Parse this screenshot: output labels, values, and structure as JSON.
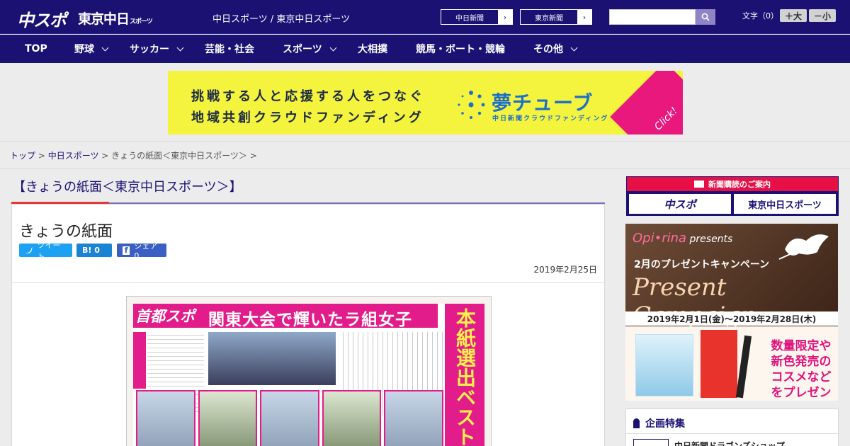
{
  "header": {
    "logo_chuspo": "中スポ",
    "logo_tokyo": "東京中日",
    "logo_tokyo_sub": "スポーツ",
    "site_title": "中日スポーツ / 東京中日スポーツ",
    "links": [
      {
        "label": "中日新聞",
        "icon": "chevron-right-icon"
      },
      {
        "label": "東京新聞",
        "icon": "chevron-right-icon"
      }
    ],
    "search_placeholder": "",
    "search_icon": "search-icon",
    "font_size_label": "文字（0）",
    "font_bigger": "＋大",
    "font_smaller": "－小"
  },
  "nav": [
    {
      "label": "TOP",
      "dropdown": false
    },
    {
      "label": "野球",
      "dropdown": true
    },
    {
      "label": "サッカー",
      "dropdown": true
    },
    {
      "label": "芸能・社会",
      "dropdown": false
    },
    {
      "label": "スポーツ",
      "dropdown": true
    },
    {
      "label": "大相撲",
      "dropdown": false
    },
    {
      "label": "競馬・ボート・競輪",
      "dropdown": false
    },
    {
      "label": "その他",
      "dropdown": true
    }
  ],
  "banner": {
    "line1": "挑戦する人と応援する人をつなぐ",
    "line2": "地域共創クラウドファンディング",
    "brand": "夢チューブ",
    "brand_sub": "中日新聞クラウドファンディング",
    "click": "Click!"
  },
  "breadcrumb": {
    "top": "トップ",
    "sep1": " > ",
    "parent": "中日スポーツ",
    "sep2": " > ",
    "current": "きょうの紙面＜東京中日スポーツ＞",
    "sep3": " >"
  },
  "section": {
    "heading": "【きょうの紙面＜東京中日スポーツ＞】"
  },
  "article": {
    "title": "きょうの紙面",
    "share": {
      "tweet": "ツイート",
      "hatena": "B! 0",
      "facebook": "シェア 0"
    },
    "date": "2019年2月25日"
  },
  "newspaper": {
    "masthead": "首都スポ",
    "headline": "関東大会で輝いたラ組女子",
    "side_headline": "本紙選出ベスト"
  },
  "sidebar": {
    "subscription": {
      "heading": "新聞購読のご案内",
      "btn1": "中スポ",
      "btn2": "東京中日スポーツ"
    },
    "promo": {
      "brand": "Opi•rina",
      "brand_suffix": " presents",
      "line1": "2月のプレゼントキャンペーン",
      "line2": "Present Campaign",
      "dates": "2019年2月1日(金)～2019年2月28日(木)",
      "copy": "数量限定や新色発売のコスメなどをプレゼント!"
    },
    "feature": {
      "heading": "企画特集",
      "item": "中日新聞ドラゴンズショップ"
    }
  }
}
